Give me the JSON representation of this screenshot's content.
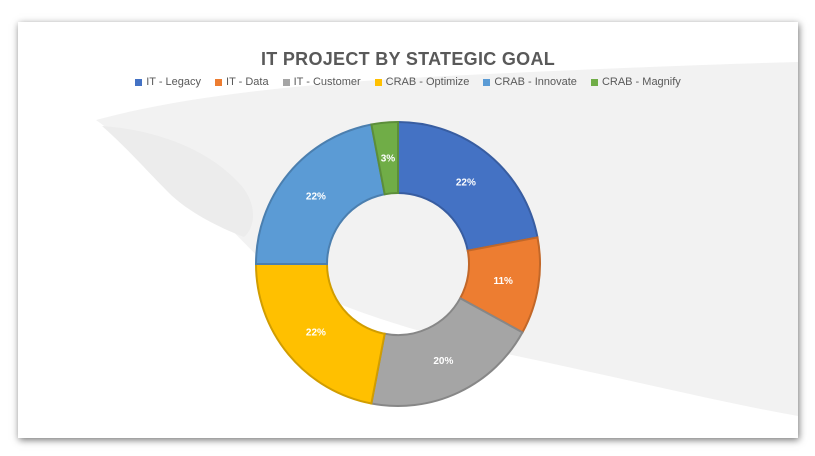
{
  "chart_data": {
    "type": "pie",
    "title": "IT PROJECT BY STATEGIC GOAL",
    "categories": [
      "IT - Legacy",
      "IT - Data",
      "IT - Customer",
      "CRAB - Optimize",
      "CRAB - Innovate",
      "CRAB - Magnify"
    ],
    "values": [
      22,
      11,
      20,
      22,
      22,
      3
    ],
    "labels": [
      "22%",
      "11%",
      "20%",
      "22%",
      "22%",
      "3%"
    ],
    "colors": [
      "#4472C4",
      "#ED7D31",
      "#A5A5A5",
      "#FFC000",
      "#5B9BD5",
      "#70AD47"
    ],
    "donut": true,
    "legend": "top"
  }
}
